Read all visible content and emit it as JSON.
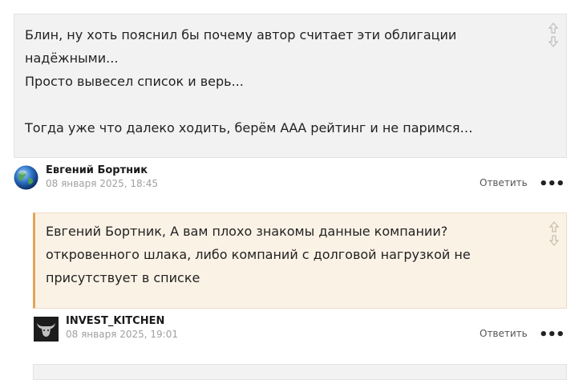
{
  "comments": [
    {
      "lines": [
        "Блин, ну хоть пояснил бы почему автор считает эти облигации надёжными...",
        "Просто вывесел список и верь...",
        "",
        "Тогда уже что далеко ходить, берём ААА рейтинг и не паримся…"
      ],
      "author": "Евгений Бортник",
      "date": "08 января 2025, 18:45",
      "reply_label": "Ответить",
      "more_label": "•••",
      "avatar_icon": "globe-icon"
    },
    {
      "lines": [
        "Евгений Бортник, А вам плохо знакомы данные компании? откровенного шлака, либо компаний с долговой нагрузкой не присутствует в списке"
      ],
      "author": "INVEST_KITCHEN",
      "date": "08 января 2025, 19:01",
      "reply_label": "Ответить",
      "more_label": "•••",
      "avatar_icon": "bull-icon"
    }
  ],
  "colors": {
    "comment_bg": "#f2f2f2",
    "reply_bg": "#fbf2e6",
    "reply_accent": "#e6a35a",
    "date": "#a0a0a0"
  }
}
